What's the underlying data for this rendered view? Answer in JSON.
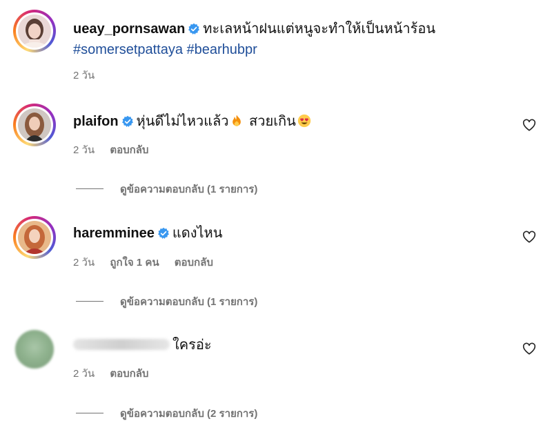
{
  "post": {
    "username": "ueay_pornsawan",
    "caption": "ทะเลหน้าฝนแต่หนูจะทำให้เป็นหน้าร้อน",
    "hashtags": "#somersetpattaya #bearhubpr",
    "time": "2 วัน"
  },
  "comments": [
    {
      "username": "plaifon",
      "verified": true,
      "text": "หุ่นดีไม่ไหวแล้ว",
      "text2": " สวยเกิน",
      "emoji": [
        "fire-emoji",
        "heart-eyes-emoji"
      ],
      "time": "2 วัน",
      "reply_label": "ตอบกลับ",
      "view_replies": "ดูข้อความตอบกลับ (1 รายการ)"
    },
    {
      "username": "haremminee",
      "verified": true,
      "text": "แดงไหน",
      "time": "2 วัน",
      "likes": "ถูกใจ 1 คน",
      "reply_label": "ตอบกลับ",
      "view_replies": "ดูข้อความตอบกลับ (1 รายการ)"
    },
    {
      "username": "",
      "verified": false,
      "text": "ใครอ่ะ",
      "time": "2 วัน",
      "reply_label": "ตอบกลับ",
      "view_replies": "ดูข้อความตอบกลับ (2 รายการ)"
    }
  ],
  "colors": {
    "verified": "#3897f0",
    "hashtag": "#1f4e99",
    "meta": "#737373"
  }
}
